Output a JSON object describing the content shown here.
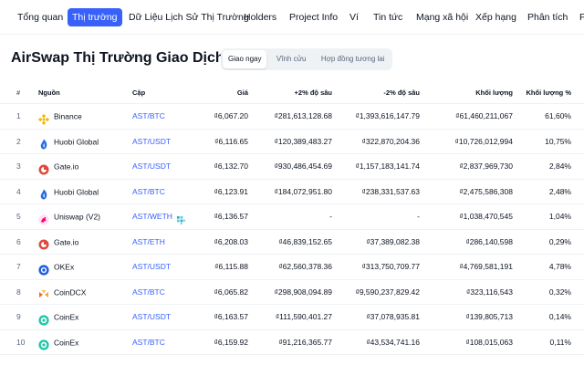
{
  "nav": {
    "items": [
      {
        "label": "Tổng quan",
        "active": false
      },
      {
        "label": "Thị trường",
        "active": true
      },
      {
        "label": "Dữ Liệu Lịch Sử Thị Trường",
        "active": false
      },
      {
        "label": "Holders",
        "active": false
      },
      {
        "label": "Project Info",
        "active": false
      },
      {
        "label": "Ví",
        "active": false
      },
      {
        "label": "Tin tức",
        "active": false
      },
      {
        "label": "Mạng xã hội",
        "active": false
      },
      {
        "label": "Xếp hạng",
        "active": false
      },
      {
        "label": "Phân tích",
        "active": false
      },
      {
        "label": "P",
        "active": false
      }
    ]
  },
  "page": {
    "title": "AirSwap Thị Trường Giao Dịch"
  },
  "market_tabs": [
    {
      "label": "Giao ngay",
      "active": true
    },
    {
      "label": "Vĩnh cửu",
      "active": false
    },
    {
      "label": "Hợp đồng tương lai",
      "active": false
    }
  ],
  "table": {
    "headers": {
      "rank": "#",
      "source": "Nguồn",
      "pair": "Cặp",
      "price": "Giá",
      "depth_plus": "+2% độ sâu",
      "depth_minus": "-2% độ sâu",
      "volume": "Khối lượng",
      "volume_pct": "Khối lượng %"
    },
    "rows": [
      {
        "rank": "1",
        "source": "Binance",
        "logo": "binance-logo",
        "pair": "AST/BTC",
        "price": "₫6,067.20",
        "depth_plus": "₫281,613,128.68",
        "depth_minus": "₫1,393,616,147.79",
        "volume": "₫61,460,211,067",
        "volume_pct": "61,60%"
      },
      {
        "rank": "2",
        "source": "Huobi Global",
        "logo": "huobi-logo",
        "pair": "AST/USDT",
        "price": "₫6,116.65",
        "depth_plus": "₫120,389,483.27",
        "depth_minus": "₫322,870,204.36",
        "volume": "₫10,726,012,994",
        "volume_pct": "10,75%"
      },
      {
        "rank": "3",
        "source": "Gate.io",
        "logo": "gateio-logo",
        "pair": "AST/USDT",
        "price": "₫6,132.70",
        "depth_plus": "₫930,486,454.69",
        "depth_minus": "₫1,157,183,141.74",
        "volume": "₫2,837,969,730",
        "volume_pct": "2,84%"
      },
      {
        "rank": "4",
        "source": "Huobi Global",
        "logo": "huobi-logo",
        "pair": "AST/BTC",
        "price": "₫6,123.91",
        "depth_plus": "₫184,072,951.80",
        "depth_minus": "₫238,331,537.63",
        "volume": "₫2,475,586,308",
        "volume_pct": "2,48%"
      },
      {
        "rank": "5",
        "source": "Uniswap (V2)",
        "logo": "uniswap-logo",
        "pair": "AST/WETH",
        "pair_badge": "dex-badge-icon",
        "price": "₫6,136.57",
        "depth_plus": "-",
        "depth_minus": "-",
        "volume": "₫1,038,470,545",
        "volume_pct": "1,04%"
      },
      {
        "rank": "6",
        "source": "Gate.io",
        "logo": "gateio-logo",
        "pair": "AST/ETH",
        "price": "₫6,208.03",
        "depth_plus": "₫46,839,152.65",
        "depth_minus": "₫37,389,082.38",
        "volume": "₫286,140,598",
        "volume_pct": "0,29%"
      },
      {
        "rank": "7",
        "source": "OKEx",
        "logo": "okex-logo",
        "pair": "AST/USDT",
        "price": "₫6,115.88",
        "depth_plus": "₫62,560,378.36",
        "depth_minus": "₫313,750,709.77",
        "volume": "₫4,769,581,191",
        "volume_pct": "4,78%"
      },
      {
        "rank": "8",
        "source": "CoinDCX",
        "logo": "coindcx-logo",
        "pair": "AST/BTC",
        "price": "₫6,065.82",
        "depth_plus": "₫298,908,094.89",
        "depth_minus": "₫9,590,237,829.42",
        "volume": "₫323,116,543",
        "volume_pct": "0,32%"
      },
      {
        "rank": "9",
        "source": "CoinEx",
        "logo": "coinex-logo",
        "pair": "AST/USDT",
        "price": "₫6,163.57",
        "depth_plus": "₫111,590,401.27",
        "depth_minus": "₫37,078,935.81",
        "volume": "₫139,805,713",
        "volume_pct": "0,14%"
      },
      {
        "rank": "10",
        "source": "CoinEx",
        "logo": "coinex-logo",
        "pair": "AST/BTC",
        "price": "₫6,159.92",
        "depth_plus": "₫91,216,365.77",
        "depth_minus": "₫43,534,741.16",
        "volume": "₫108,015,063",
        "volume_pct": "0,11%"
      }
    ]
  },
  "colors": {
    "accent": "#3861fb",
    "text": "#0d1421",
    "muted": "#58667e",
    "divider": "#eff2f5",
    "binance": "#f0b90b",
    "huobi": "#2a6ce0",
    "gateio": "#e0473d",
    "uniswap": "#ff007a",
    "okex": "#1f5fe0",
    "coindcx": "#f26a21",
    "coinex": "#1fc7a8"
  }
}
